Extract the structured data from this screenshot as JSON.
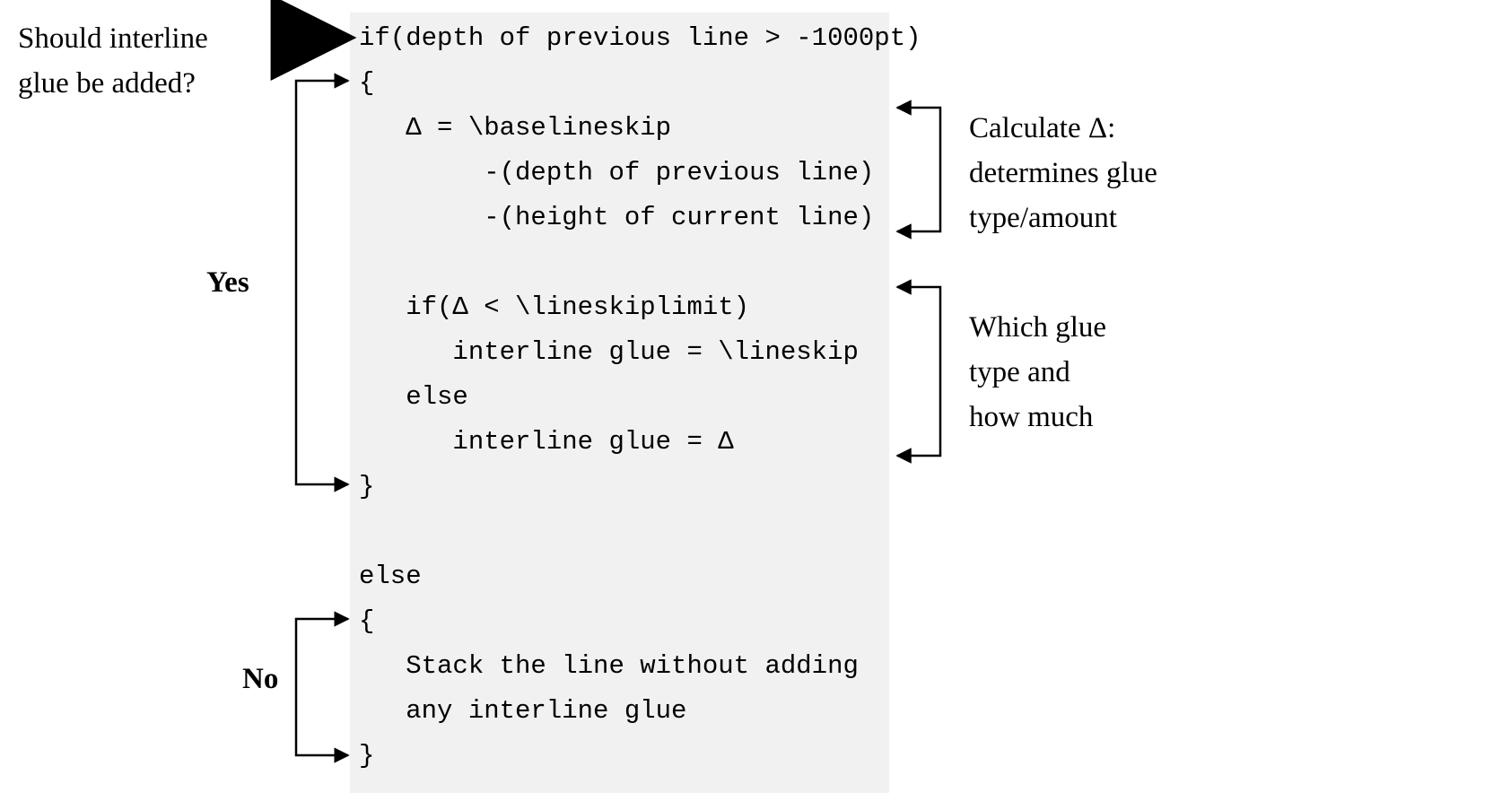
{
  "codebox": {
    "bg": "#f1f1f1"
  },
  "code": {
    "l1": "if(depth of previous line > -1000pt)",
    "l2": "{",
    "l3": "   Δ = \\baselineskip",
    "l4": "        -(depth of previous line)",
    "l5": "        -(height of current line)",
    "l6": "",
    "l7": "   if(Δ < \\lineskiplimit)",
    "l8": "      interline glue = \\lineskip",
    "l9": "   else",
    "l10": "      interline glue = Δ",
    "l11": "}",
    "l12": "",
    "l13": "else",
    "l14": "{",
    "l15": "   Stack the line without adding",
    "l16": "   any interline glue",
    "l17": "}"
  },
  "ann": {
    "q1a": "Should interline",
    "q1b": "glue be added?",
    "yes": "Yes",
    "no": "No",
    "r1a": "Calculate Δ:",
    "r1b": "determines glue",
    "r1c": "type/amount",
    "r2a": "Which glue",
    "r2b": "type and",
    "r2c": "how much"
  }
}
